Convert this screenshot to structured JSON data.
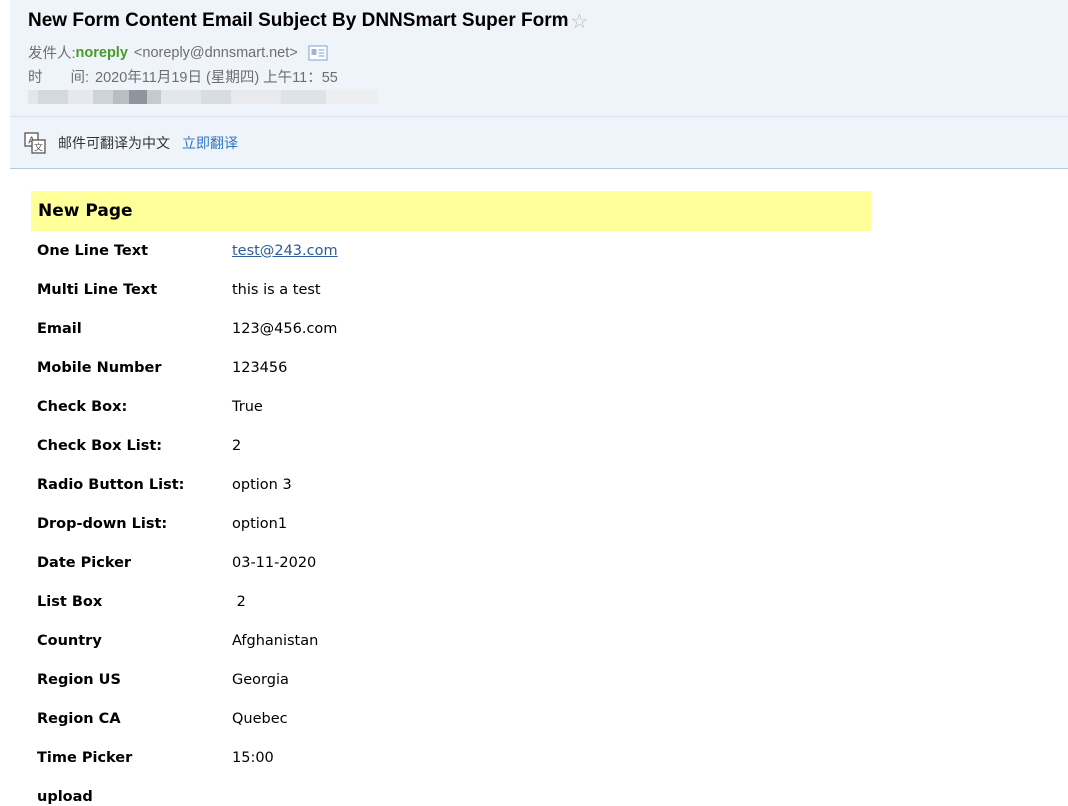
{
  "header": {
    "subject": "New Form Content Email Subject By DNNSmart Super Form",
    "star_glyph": "☆",
    "from_label": "发件人:",
    "sender_name": "noreply",
    "sender_address": "<noreply@dnnsmart.net>",
    "time_label_1": "时",
    "time_label_2": "间:",
    "time_value": "2020年11月19日 (星期四) 上午11：55"
  },
  "translate_bar": {
    "text": "邮件可翻译为中文",
    "link": "立即翻译"
  },
  "form": {
    "section_title": "New Page",
    "fields": [
      {
        "label": "One Line Text",
        "value": "test@243.com"
      },
      {
        "label": "Multi Line Text",
        "value": "this is a test"
      },
      {
        "label": "Email",
        "value": "123@456.com"
      },
      {
        "label": "Mobile Number",
        "value": "123456"
      },
      {
        "label": "Check Box:",
        "value": "True"
      },
      {
        "label": "Check Box List:",
        "value": "2"
      },
      {
        "label": "Radio Button List:",
        "value": "option 3"
      },
      {
        "label": "Drop-down List:",
        "value": "option1"
      },
      {
        "label": "Date Picker",
        "value": "03-11-2020"
      },
      {
        "label": "List Box",
        "value": " 2"
      },
      {
        "label": "Country",
        "value": "Afghanistan"
      },
      {
        "label": "Region US",
        "value": "Georgia"
      },
      {
        "label": "Region CA",
        "value": "Quebec"
      },
      {
        "label": "Time Picker",
        "value": "15:00"
      },
      {
        "label": "upload",
        "value": ""
      }
    ]
  },
  "colors": {
    "header_bg": "#eff4fa",
    "sender_green": "#4a9a2a",
    "link_blue": "#2c77c5",
    "section_yellow": "#ffff99"
  },
  "icons": {
    "star": "star-outline-icon",
    "contact": "contact-card-icon",
    "translate": "translate-icon"
  }
}
